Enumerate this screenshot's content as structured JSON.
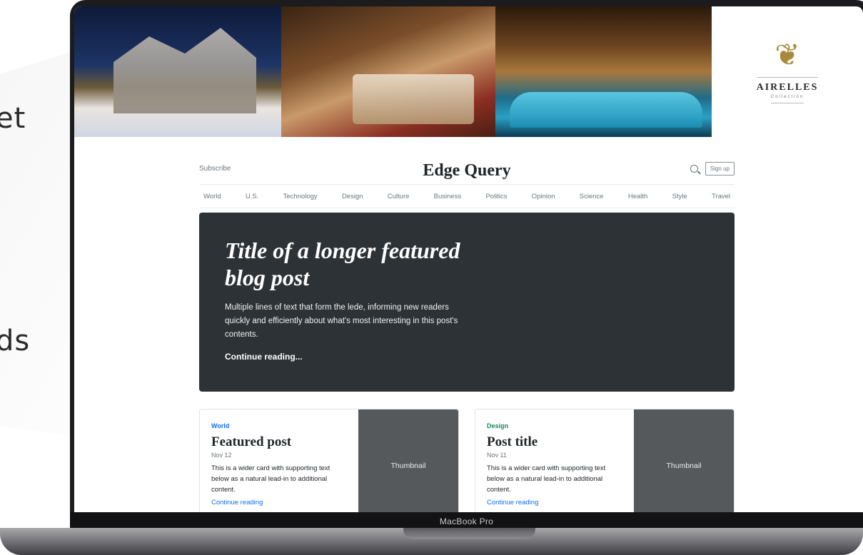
{
  "side_text": [
    "et",
    "ds"
  ],
  "device_label": "MacBook Pro",
  "banner": {
    "brand_name": "AIRELLES",
    "brand_sub": "Collection",
    "brand_icon": "olive-branch-icon"
  },
  "site": {
    "subscribe": "Subscribe",
    "title": "Edge Query",
    "signup": "Sign up",
    "nav": [
      "World",
      "U.S.",
      "Technology",
      "Design",
      "Culture",
      "Business",
      "Politics",
      "Opinion",
      "Science",
      "Health",
      "Style",
      "Travel"
    ]
  },
  "hero": {
    "title": "Title of a longer featured blog post",
    "lede": "Multiple lines of text that form the lede, informing new readers quickly and efficiently about what's most interesting in this post's contents.",
    "link": "Continue reading..."
  },
  "cards": [
    {
      "category": "World",
      "title": "Featured post",
      "date": "Nov 12",
      "text": "This is a wider card with supporting text below as a natural lead-in to additional content.",
      "link": "Continue reading",
      "thumb": "Thumbnail"
    },
    {
      "category": "Design",
      "title": "Post title",
      "date": "Nov 11",
      "text": "This is a wider card with supporting text below as a natural lead-in to additional content.",
      "link": "Continue reading",
      "thumb": "Thumbnail"
    }
  ],
  "colors": {
    "hero_bg": "#2c3236",
    "link": "#0d6efd",
    "world": "#0d6efd",
    "design": "#198754",
    "thumb_bg": "#55595c"
  }
}
